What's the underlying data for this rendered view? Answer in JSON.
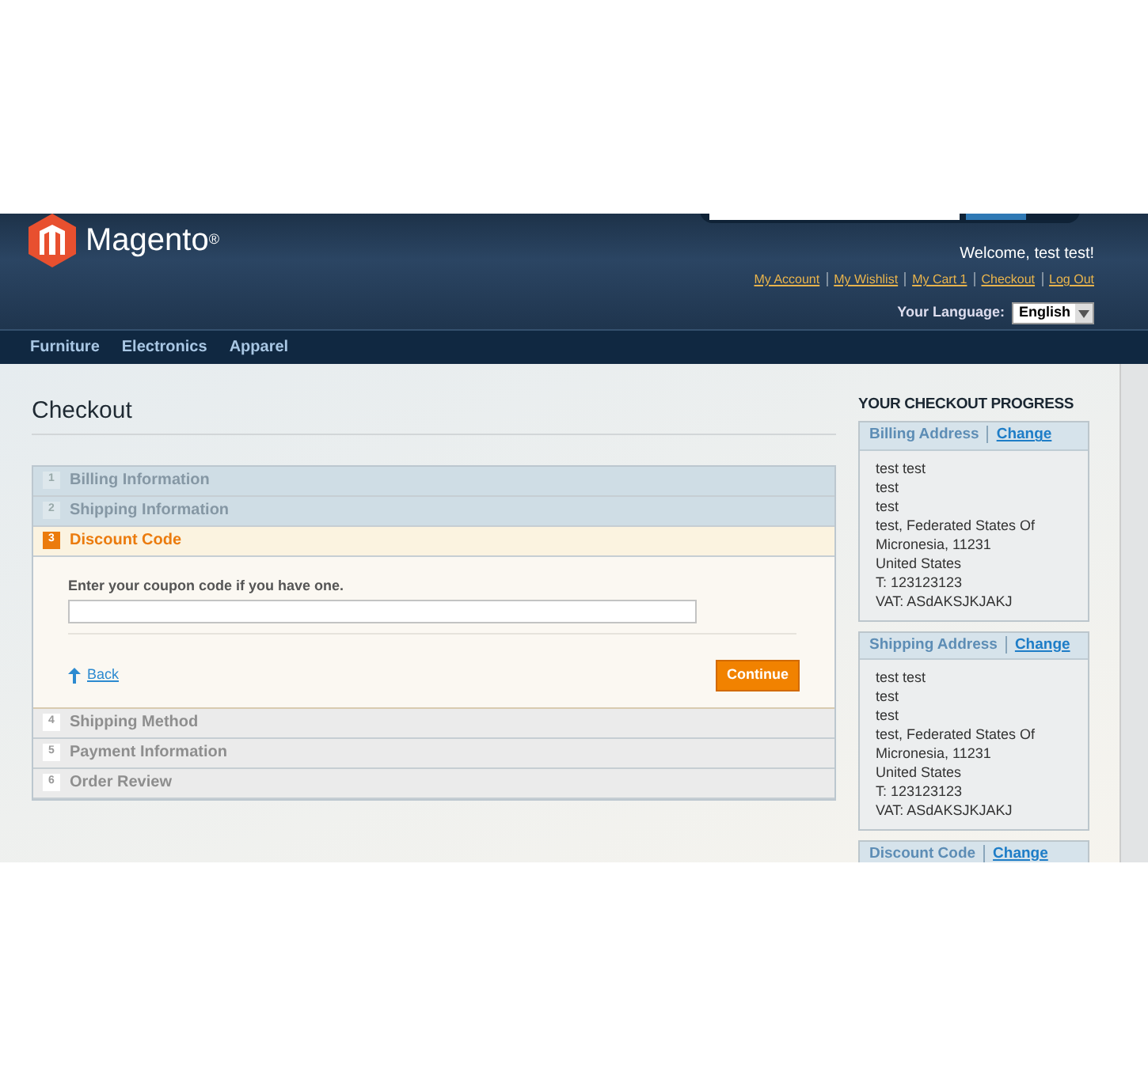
{
  "header": {
    "logo_text": "Magento",
    "logo_mark": "®",
    "welcome": "Welcome, test test!",
    "links": [
      "My Account",
      "My Wishlist",
      "My Cart 1",
      "Checkout",
      "Log Out"
    ],
    "language_label": "Your Language:",
    "language_value": "English"
  },
  "nav": [
    "Furniture",
    "Electronics",
    "Apparel"
  ],
  "page_title": "Checkout",
  "steps": [
    {
      "number": "1",
      "title": "Billing Information",
      "complete": true,
      "selected": false
    },
    {
      "number": "2",
      "title": "Shipping Information",
      "complete": true,
      "selected": false
    },
    {
      "number": "3",
      "title": "Discount Code",
      "complete": false,
      "selected": true
    },
    {
      "number": "4",
      "title": "Shipping Method",
      "complete": false,
      "selected": false
    },
    {
      "number": "5",
      "title": "Payment Information",
      "complete": false,
      "selected": false
    },
    {
      "number": "6",
      "title": "Order Review",
      "complete": false,
      "selected": false
    }
  ],
  "discount": {
    "label": "Enter your coupon code if you have one.",
    "back": "Back",
    "continue": "Continue"
  },
  "progress": {
    "title": "YOUR CHECKOUT PROGRESS",
    "sections": [
      {
        "title": "Billing Address",
        "change": "Change",
        "lines": [
          "test test",
          "test",
          "test",
          "test, Federated States Of",
          "Micronesia, 11231",
          "United States",
          "T: 123123123",
          "VAT: ASdAKSJKJAKJ"
        ]
      },
      {
        "title": "Shipping Address",
        "change": "Change",
        "lines": [
          "test test",
          "test",
          "test",
          "test, Federated States Of",
          "Micronesia, 11231",
          "United States",
          "T: 123123123",
          "VAT: ASdAKSJKJAKJ"
        ]
      },
      {
        "title": "Discount Code",
        "change": "Change"
      }
    ]
  }
}
